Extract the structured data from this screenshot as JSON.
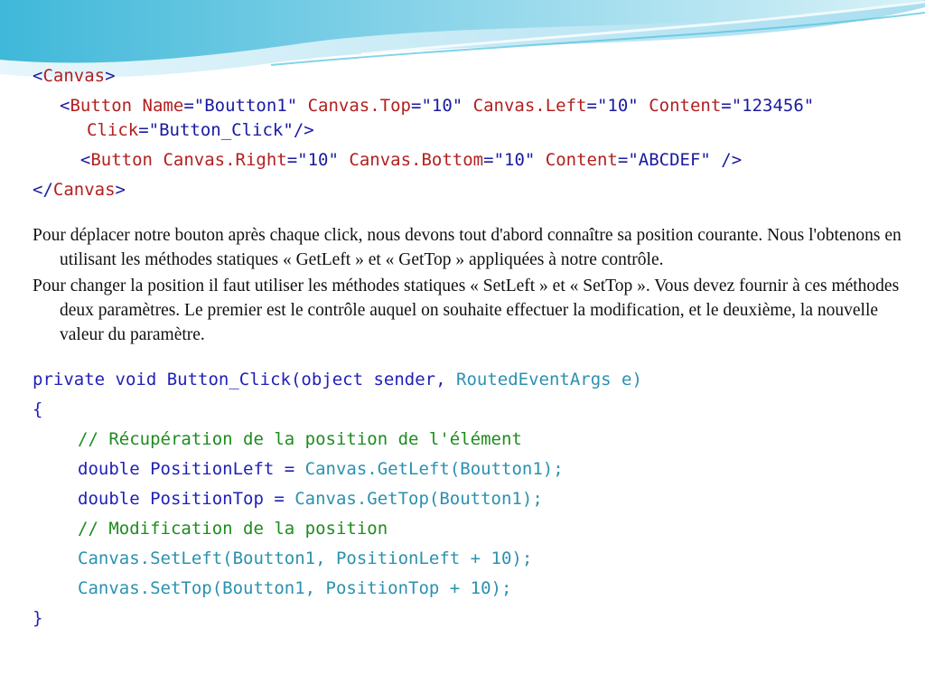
{
  "xaml": {
    "line1": {
      "open": "<",
      "tag": "Canvas",
      "close": ">"
    },
    "line2": {
      "lt": "<",
      "tag": "Button",
      "a1": "Name",
      "eq1": "=",
      "v1": "\"Boutton1\"",
      "a2": "Canvas.Top",
      "eq2": "=",
      "v2": "\"10\"",
      "a3": "Canvas.Left",
      "eq3": "=",
      "v3": "\"10\"",
      "a4": "Content",
      "eq4": "=",
      "v4": "\"123456\"",
      "a5": "Click",
      "eq5": "=",
      "v5": "\"Button_Click\"",
      "end": "/>"
    },
    "line3": {
      "lt": "<",
      "tag": "Button",
      "a1": "Canvas.Right",
      "eq1": "=",
      "v1": "\"10\"",
      "a2": "Canvas.Bottom",
      "eq2": "=",
      "v2": "\"10\"",
      "a3": "Content",
      "eq3": "=",
      "v3": "\"ABCDEF\"",
      "end": "/>"
    },
    "line4": {
      "open": "</",
      "tag": "Canvas",
      "close": ">"
    }
  },
  "paragraphs": [
    "Pour déplacer notre bouton après chaque click, nous devons tout d'abord connaître sa position courante. Nous l'obtenons en utilisant les méthodes statiques « GetLeft » et « GetTop » appliquées à notre contrôle.",
    "Pour changer la position il faut utiliser les méthodes statiques « SetLeft » et « SetTop ». Vous devez fournir à ces méthodes deux paramètres. Le premier est le contrôle auquel on souhaite effectuer la modification, et le deuxième, la nouvelle valeur du paramètre."
  ],
  "csharp": {
    "signature_a": "private void Button_Click(object sender, ",
    "signature_b": "RoutedEventArgs e)",
    "open_brace": "{",
    "comment1": "// Récupération de la position de l'élément",
    "line_left_a": "double PositionLeft = ",
    "line_left_b": "Canvas.GetLeft(Boutton1);",
    "line_top_a": "double PositionTop = ",
    "line_top_b": "Canvas.GetTop(Boutton1);",
    "comment2": "// Modification de la position",
    "set_left": "Canvas.SetLeft(Boutton1, PositionLeft + 10);",
    "set_top": "Canvas.SetTop(Boutton1, PositionTop + 10);",
    "close_brace": "}"
  },
  "colors": {
    "keyword": "#1f1fb8",
    "xml_attribute": "#b22020",
    "type_name": "#2b91af",
    "comment": "#1e8c1e",
    "wave_light": "#bfe6f2",
    "wave_dark": "#35b4d6"
  }
}
